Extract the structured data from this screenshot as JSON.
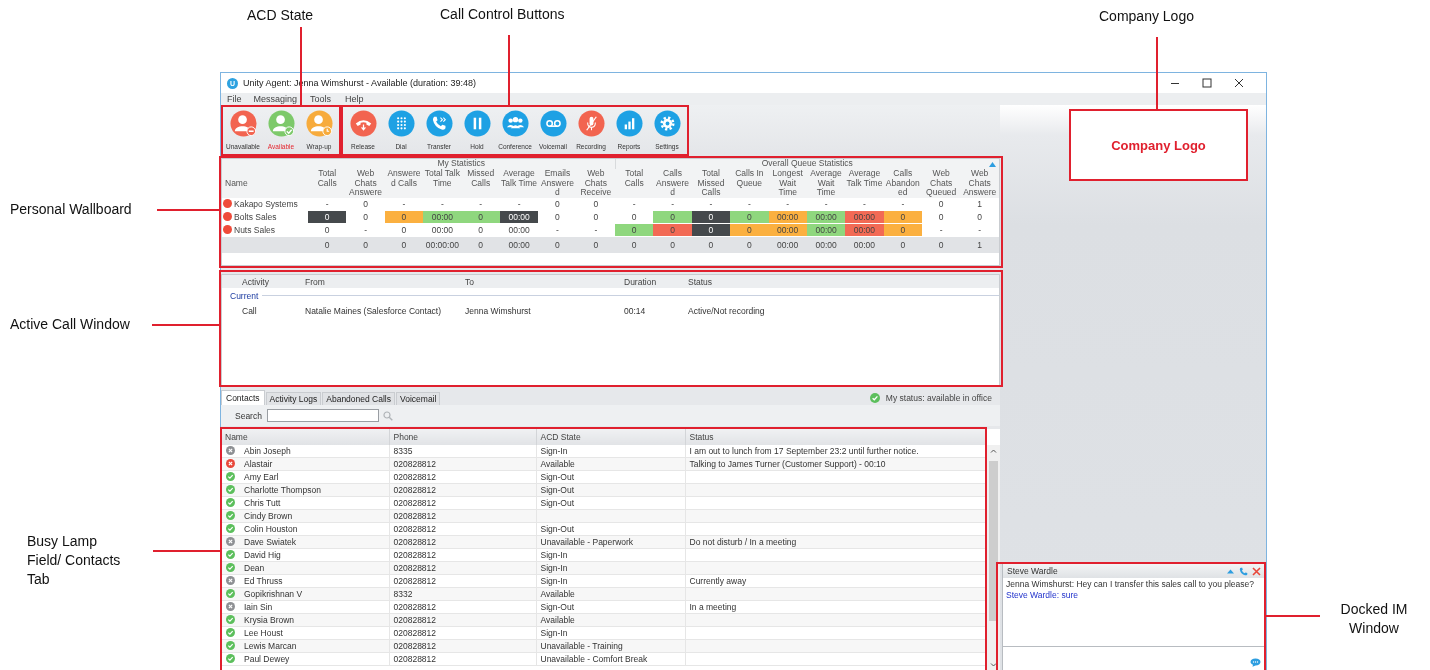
{
  "annotations": [
    {
      "label": "ACD State"
    },
    {
      "label": "Call Control Buttons"
    },
    {
      "label": "Company Logo"
    },
    {
      "label": "Personal Wallboard"
    },
    {
      "label": "Active Call Window"
    },
    {
      "label": "Busy Lamp Field/ Contacts Tab"
    },
    {
      "label": "Docked IM Window"
    }
  ],
  "company_logo": {
    "text": "Company Logo"
  },
  "window": {
    "icon_text": "U",
    "title": "Unity Agent: Jenna Wimshurst - Available (duration: 39:48)"
  },
  "menu": [
    "File",
    "Messaging",
    "Tools",
    "Help"
  ],
  "acd_buttons": [
    {
      "label": "Unavailable",
      "kind": "unavailable",
      "selected": false
    },
    {
      "label": "Available",
      "kind": "available",
      "selected": true
    },
    {
      "label": "Wrap-up",
      "kind": "wrapup",
      "selected": false
    }
  ],
  "call_buttons": [
    {
      "label": "Release",
      "kind": "release"
    },
    {
      "label": "Dial",
      "kind": "dial"
    },
    {
      "label": "Transfer",
      "kind": "transfer"
    },
    {
      "label": "Hold",
      "kind": "hold"
    },
    {
      "label": "Conference",
      "kind": "conference"
    },
    {
      "label": "Voicemail",
      "kind": "voicemail"
    },
    {
      "label": "Recording",
      "kind": "recording"
    },
    {
      "label": "Reports",
      "kind": "reports"
    },
    {
      "label": "Settings",
      "kind": "settings"
    }
  ],
  "wallboard": {
    "name_column": "Name",
    "groups": [
      {
        "title": "My Statistics",
        "columns": [
          "Total Calls",
          "Web Chats Answere",
          "Answere d Calls",
          "Total Talk Time",
          "Missed Calls",
          "Average Talk Time",
          "Emails Answere d",
          "Web Chats Receive"
        ]
      },
      {
        "title": "Overall Queue Statistics",
        "columns": [
          "Total Calls",
          "Calls Answere d",
          "Total Missed Calls",
          "Calls In Queue",
          "Longest Wait Time",
          "Average Wait Time",
          "Average Talk Time",
          "Calls Abandon ed",
          "Web Chats Queued",
          "Web Chats Answere"
        ]
      }
    ],
    "rows": [
      {
        "name": "Kakapo Systems",
        "color": "#ef4b3a",
        "cells": [
          {
            "text": "-"
          },
          {
            "text": "0"
          },
          {
            "text": "-"
          },
          {
            "text": "-"
          },
          {
            "text": "-"
          },
          {
            "text": "-"
          },
          {
            "text": "0"
          },
          {
            "text": "0"
          },
          {
            "text": "-"
          },
          {
            "text": "-"
          },
          {
            "text": "-"
          },
          {
            "text": "-"
          },
          {
            "text": "-"
          },
          {
            "text": "-"
          },
          {
            "text": "-"
          },
          {
            "text": "-"
          },
          {
            "text": "0"
          },
          {
            "text": "1"
          }
        ]
      },
      {
        "name": "Bolts Sales",
        "color": "#ef4b3a",
        "cells": [
          {
            "text": "0",
            "color": "#45494c"
          },
          {
            "text": "0"
          },
          {
            "text": "0",
            "color": "#fbb040"
          },
          {
            "text": "00:00",
            "color": "#8fd77e"
          },
          {
            "text": "0",
            "color": "#8fd77e"
          },
          {
            "text": "00:00",
            "color": "#45494c"
          },
          {
            "text": "0"
          },
          {
            "text": "0"
          },
          {
            "text": "0"
          },
          {
            "text": "0",
            "color": "#8fd77e"
          },
          {
            "text": "0",
            "color": "#45494c"
          },
          {
            "text": "0",
            "color": "#8fd77e"
          },
          {
            "text": "00:00",
            "color": "#fbb040"
          },
          {
            "text": "00:00",
            "color": "#8fd77e"
          },
          {
            "text": "00:00",
            "color": "#f26a55"
          },
          {
            "text": "0",
            "color": "#fbb040"
          },
          {
            "text": "0"
          },
          {
            "text": "0"
          }
        ]
      },
      {
        "name": "Nuts Sales",
        "color": "#ef4b3a",
        "cells": [
          {
            "text": "0"
          },
          {
            "text": "-"
          },
          {
            "text": "0"
          },
          {
            "text": "00:00"
          },
          {
            "text": "0"
          },
          {
            "text": "00:00"
          },
          {
            "text": "-"
          },
          {
            "text": "-"
          },
          {
            "text": "0",
            "color": "#8fd77e"
          },
          {
            "text": "0",
            "color": "#f26a55"
          },
          {
            "text": "0",
            "color": "#45494c"
          },
          {
            "text": "0",
            "color": "#fbb040"
          },
          {
            "text": "00:00",
            "color": "#fbb040"
          },
          {
            "text": "00:00",
            "color": "#8fd77e"
          },
          {
            "text": "00:00",
            "color": "#f26a55"
          },
          {
            "text": "0",
            "color": "#fbb040"
          },
          {
            "text": "-"
          },
          {
            "text": "-"
          }
        ]
      }
    ],
    "totals": [
      "0",
      "0",
      "0",
      "00:00:00",
      "0",
      "00:00",
      "0",
      "0",
      "0",
      "0",
      "0",
      "0",
      "00:00",
      "00:00",
      "00:00",
      "0",
      "0",
      "1"
    ]
  },
  "active_calls": {
    "columns": [
      "Activity",
      "From",
      "To",
      "Duration",
      "Status"
    ],
    "group": "Current",
    "rows": [
      [
        "Call",
        "Natalie Maines (Salesforce Contact)",
        "Jenna Wimshurst",
        "00:14",
        "Active/Not recording"
      ]
    ]
  },
  "tabs": [
    {
      "label": "Contacts",
      "selected": true
    },
    {
      "label": "Activity Logs",
      "selected": false
    },
    {
      "label": "Abandoned Calls",
      "selected": false
    },
    {
      "label": "Voicemail",
      "selected": false
    }
  ],
  "my_status": {
    "text": "My status: available in office"
  },
  "search": {
    "label": "Search"
  },
  "contacts": {
    "columns": [
      "Name",
      "Phone",
      "ACD State",
      "Status"
    ],
    "rows": [
      {
        "kind": "offline",
        "cells": [
          "Abin Joseph",
          "8335",
          "Sign-In",
          "I am out to lunch from 17 September 23:2 until further notice."
        ]
      },
      {
        "kind": "busy",
        "cells": [
          "Alastair",
          "020828812",
          "Available",
          "Talking to James Turner (Customer Support) - 00:10"
        ]
      },
      {
        "kind": "available",
        "cells": [
          "Amy Earl",
          "020828812",
          "Sign-Out",
          ""
        ]
      },
      {
        "kind": "available",
        "cells": [
          "Charlotte Thompson",
          "020828812",
          "Sign-Out",
          ""
        ]
      },
      {
        "kind": "available",
        "cells": [
          "Chris Tutt",
          "020828812",
          "Sign-Out",
          ""
        ]
      },
      {
        "kind": "available",
        "cells": [
          "Cindy Brown",
          "020828812",
          "",
          ""
        ]
      },
      {
        "kind": "available",
        "cells": [
          "Colin Houston",
          "020828812",
          "Sign-Out",
          ""
        ]
      },
      {
        "kind": "offline",
        "cells": [
          "Dave Swiatek",
          "020828812",
          "Unavailable - Paperwork",
          "Do not disturb / In a meeting"
        ]
      },
      {
        "kind": "available",
        "cells": [
          "David Hig",
          "020828812",
          "Sign-In",
          ""
        ]
      },
      {
        "kind": "available",
        "cells": [
          "Dean",
          "020828812",
          "Sign-In",
          ""
        ]
      },
      {
        "kind": "offline",
        "cells": [
          "Ed Thruss",
          "020828812",
          "Sign-In",
          "Currently away"
        ]
      },
      {
        "kind": "available",
        "cells": [
          "Gopikrishnan V",
          "8332",
          "Available",
          ""
        ]
      },
      {
        "kind": "offline",
        "cells": [
          "Iain Sin",
          "020828812",
          "Sign-Out",
          "In a meeting"
        ]
      },
      {
        "kind": "available",
        "cells": [
          "Krysia Brown",
          "020828812",
          "Available",
          ""
        ]
      },
      {
        "kind": "available",
        "cells": [
          "Lee Houst",
          "020828812",
          "Sign-In",
          ""
        ]
      },
      {
        "kind": "available",
        "cells": [
          "Lewis Marcan",
          "020828812",
          "Unavailable - Training",
          ""
        ]
      },
      {
        "kind": "available",
        "cells": [
          "Paul Dewey",
          "020828812",
          "Unavailable - Comfort Break",
          ""
        ]
      }
    ]
  },
  "im": {
    "title": "Steve Wardle",
    "messages": [
      {
        "kind": "local",
        "text": "Jenna Wimshurst: Hey can I transfer this sales call to you please?"
      },
      {
        "kind": "remote",
        "text": "Steve Wardle: sure"
      }
    ]
  }
}
